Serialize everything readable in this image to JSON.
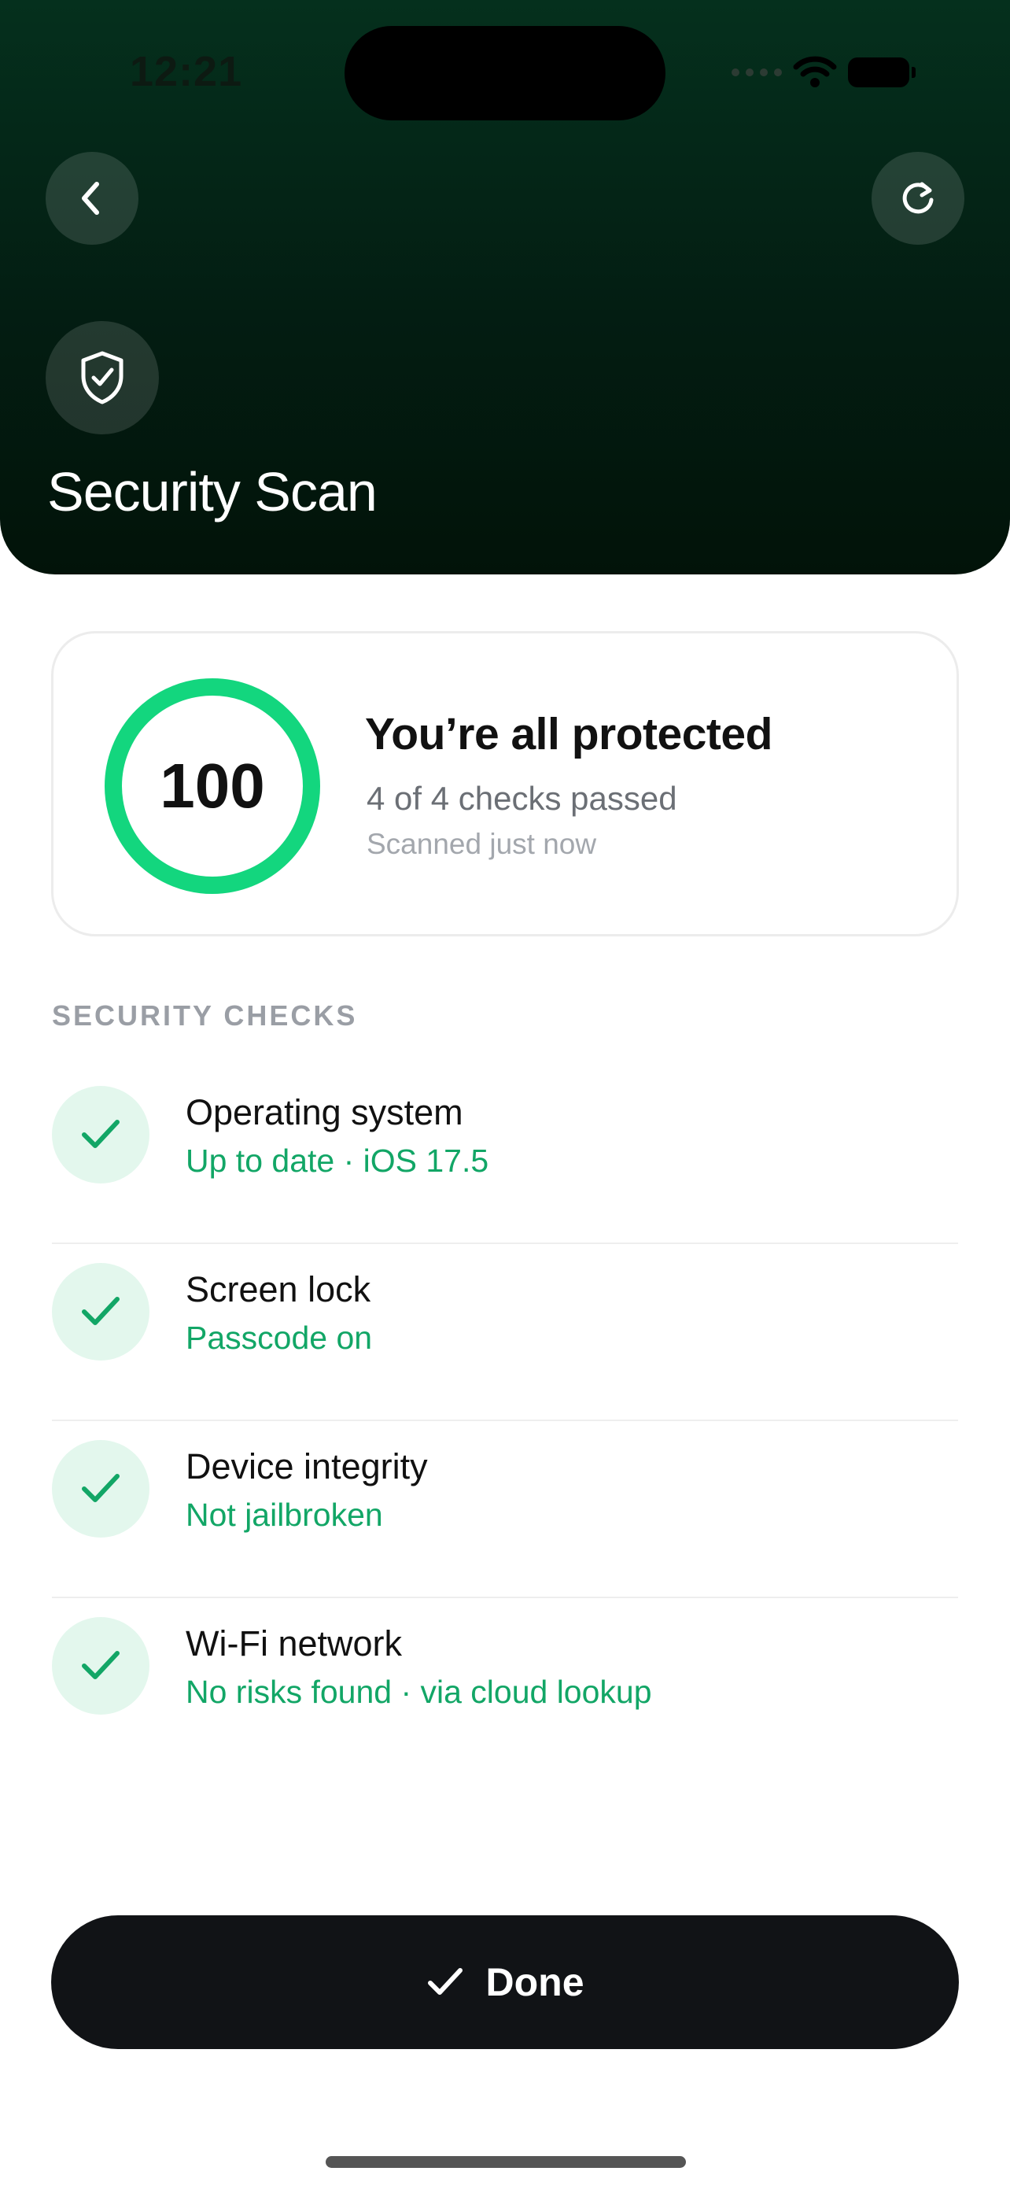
{
  "status_bar": {
    "time": "12:21"
  },
  "header": {
    "title": "Security Scan"
  },
  "summary": {
    "score": "100",
    "score_fraction": 1.0,
    "title": "You’re all protected",
    "checks_passed": "4 of 4 checks passed",
    "scanned": "Scanned just now"
  },
  "section": {
    "label": "SECURITY CHECKS"
  },
  "checks": [
    {
      "title": "Operating system",
      "status": "Up to date · iOS 17.5"
    },
    {
      "title": "Screen lock",
      "status": "Passcode on"
    },
    {
      "title": "Device integrity",
      "status": "Not jailbroken"
    },
    {
      "title": "Wi-Fi network",
      "status": "No risks found · via cloud lookup"
    }
  ],
  "done_button": {
    "label": "Done"
  },
  "colors": {
    "header_bg": "#04261a",
    "accent_green": "#12a666",
    "ring_green": "#13d67e",
    "button_bg": "#111316"
  },
  "icons": [
    "back-icon",
    "refresh-icon",
    "shield-check-icon",
    "checkmark-icon",
    "wifi-icon",
    "battery-icon"
  ]
}
